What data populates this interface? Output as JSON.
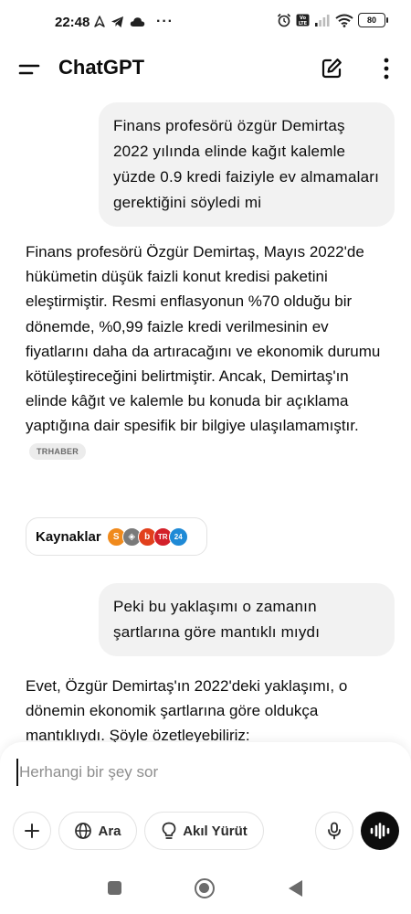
{
  "status_bar": {
    "time": "22:48",
    "more_dots": "···",
    "battery": "80"
  },
  "header": {
    "title": "ChatGPT"
  },
  "messages": [
    {
      "role": "user",
      "text": "Finans profesörü özgür Demirtaş 2022 yılında elinde kağıt kalemle yüzde 0.9 kredi faiziyle ev almamaları gerektiğini söyledi mi"
    },
    {
      "role": "assistant",
      "text": "Finans profesörü Özgür Demirtaş, Mayıs 2022'de hükümetin düşük faizli konut kredisi paketini eleştirmiştir.  Resmi enflasyonun %70 olduğu bir dönemde, %0,99 faizle kredi verilmesinin ev fiyatlarını daha da artıracağını ve ekonomik durumu kötüleştireceğini belirtmiştir.  Ancak, Demirtaş'ın elinde kâğıt ve kalemle bu konuda bir açıklama yaptığına dair spesifik bir bilgiye ulaşılamamıştır.",
      "source_chip": "TRHABER"
    },
    {
      "role": "user",
      "text": "Peki bu yaklaşımı o zamanın şartlarına göre mantıklı mıydı"
    },
    {
      "role": "assistant",
      "text": "Evet, Özgür Demirtaş'ın 2022'deki yaklaşımı, o dönemin ekonomik şartlarına göre oldukça mantıklıydı. Şöyle özetleyebiliriz:"
    }
  ],
  "sources": {
    "label": "Kaynaklar",
    "logos": [
      {
        "name": "source-logo-s",
        "glyph": "S",
        "color": "#f08a1c"
      },
      {
        "name": "source-logo-diamond",
        "glyph": "◈",
        "color": "#7a7a7a"
      },
      {
        "name": "source-logo-b",
        "glyph": "b",
        "color": "#e2401c"
      },
      {
        "name": "source-logo-tr",
        "glyph": "TR",
        "color": "#d3202a"
      },
      {
        "name": "source-logo-24",
        "glyph": "24",
        "color": "#1f8ad6"
      }
    ]
  },
  "composer": {
    "placeholder": "Herhangi bir şey sor",
    "search_label": "Ara",
    "reason_label": "Akıl Yürüt"
  },
  "icons": {
    "menu": "menu-icon",
    "edit": "new-chat-icon",
    "more": "more-vertical-icon",
    "plus": "plus-icon",
    "globe": "globe-icon",
    "bulb": "lightbulb-icon",
    "mic": "microphone-icon",
    "voice": "voice-mode-icon"
  },
  "colors": {
    "user_bubble": "#f2f2f2",
    "text": "#0d0d0d",
    "voice_button": "#0d0d0d"
  }
}
